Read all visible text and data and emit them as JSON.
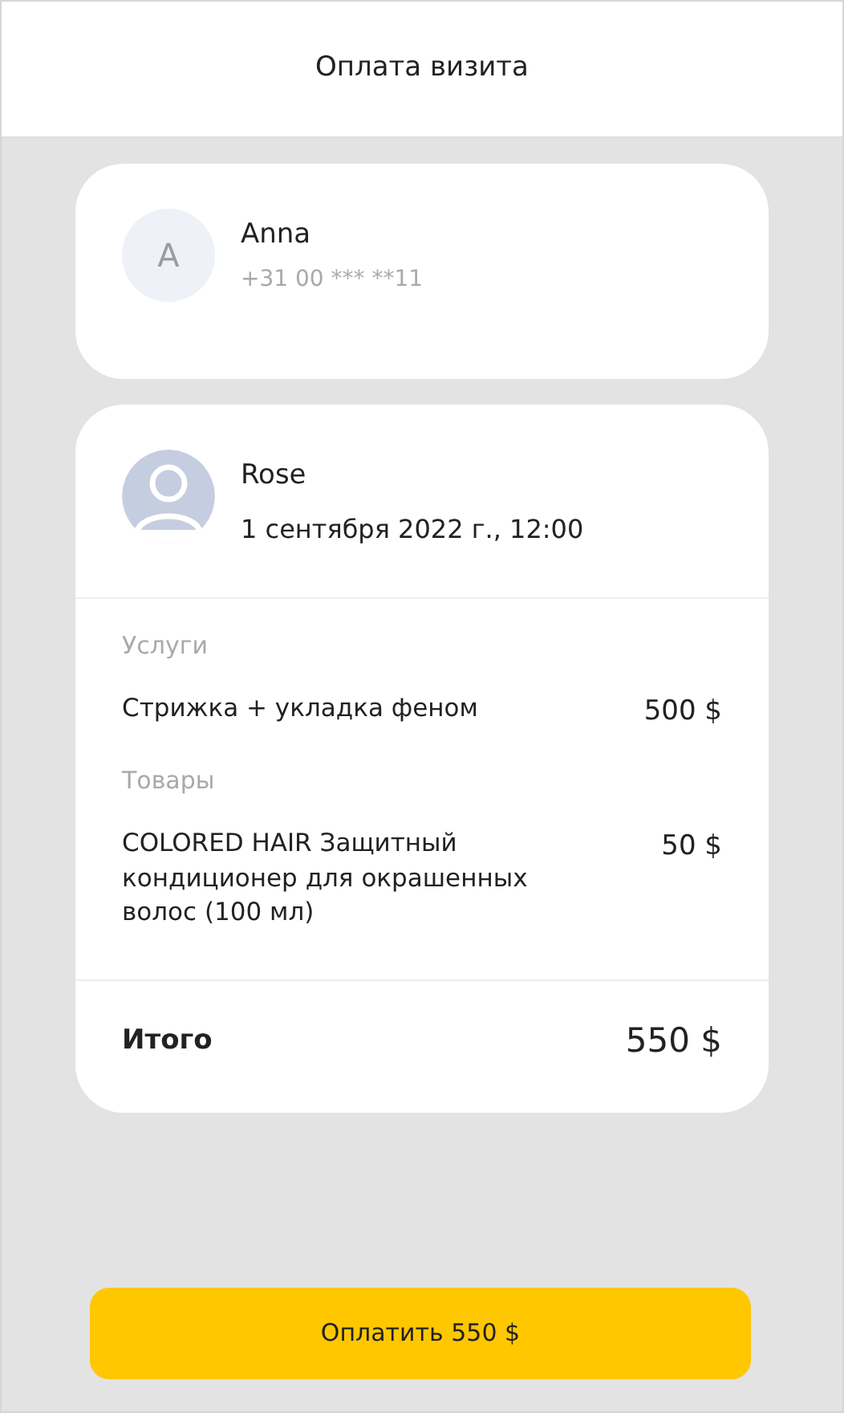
{
  "header": {
    "title": "Оплата визита"
  },
  "client": {
    "initial": "A",
    "name": "Anna",
    "phone": "+31 00 *** **11"
  },
  "visit": {
    "master": "Rose",
    "datetime": "1 сентября 2022 г., 12:00"
  },
  "sections": [
    {
      "title": "Услуги",
      "items": [
        {
          "name": "Стрижка + укладка феном",
          "price": "500 $"
        }
      ]
    },
    {
      "title": "Товары",
      "items": [
        {
          "name": "COLORED HAIR Защитный кондиционер для окрашенных волос (100 мл)",
          "price": "50 $"
        }
      ]
    }
  ],
  "total": {
    "label": "Итого",
    "amount": "550 $"
  },
  "pay_button": {
    "label": "Оплатить 550 $"
  }
}
